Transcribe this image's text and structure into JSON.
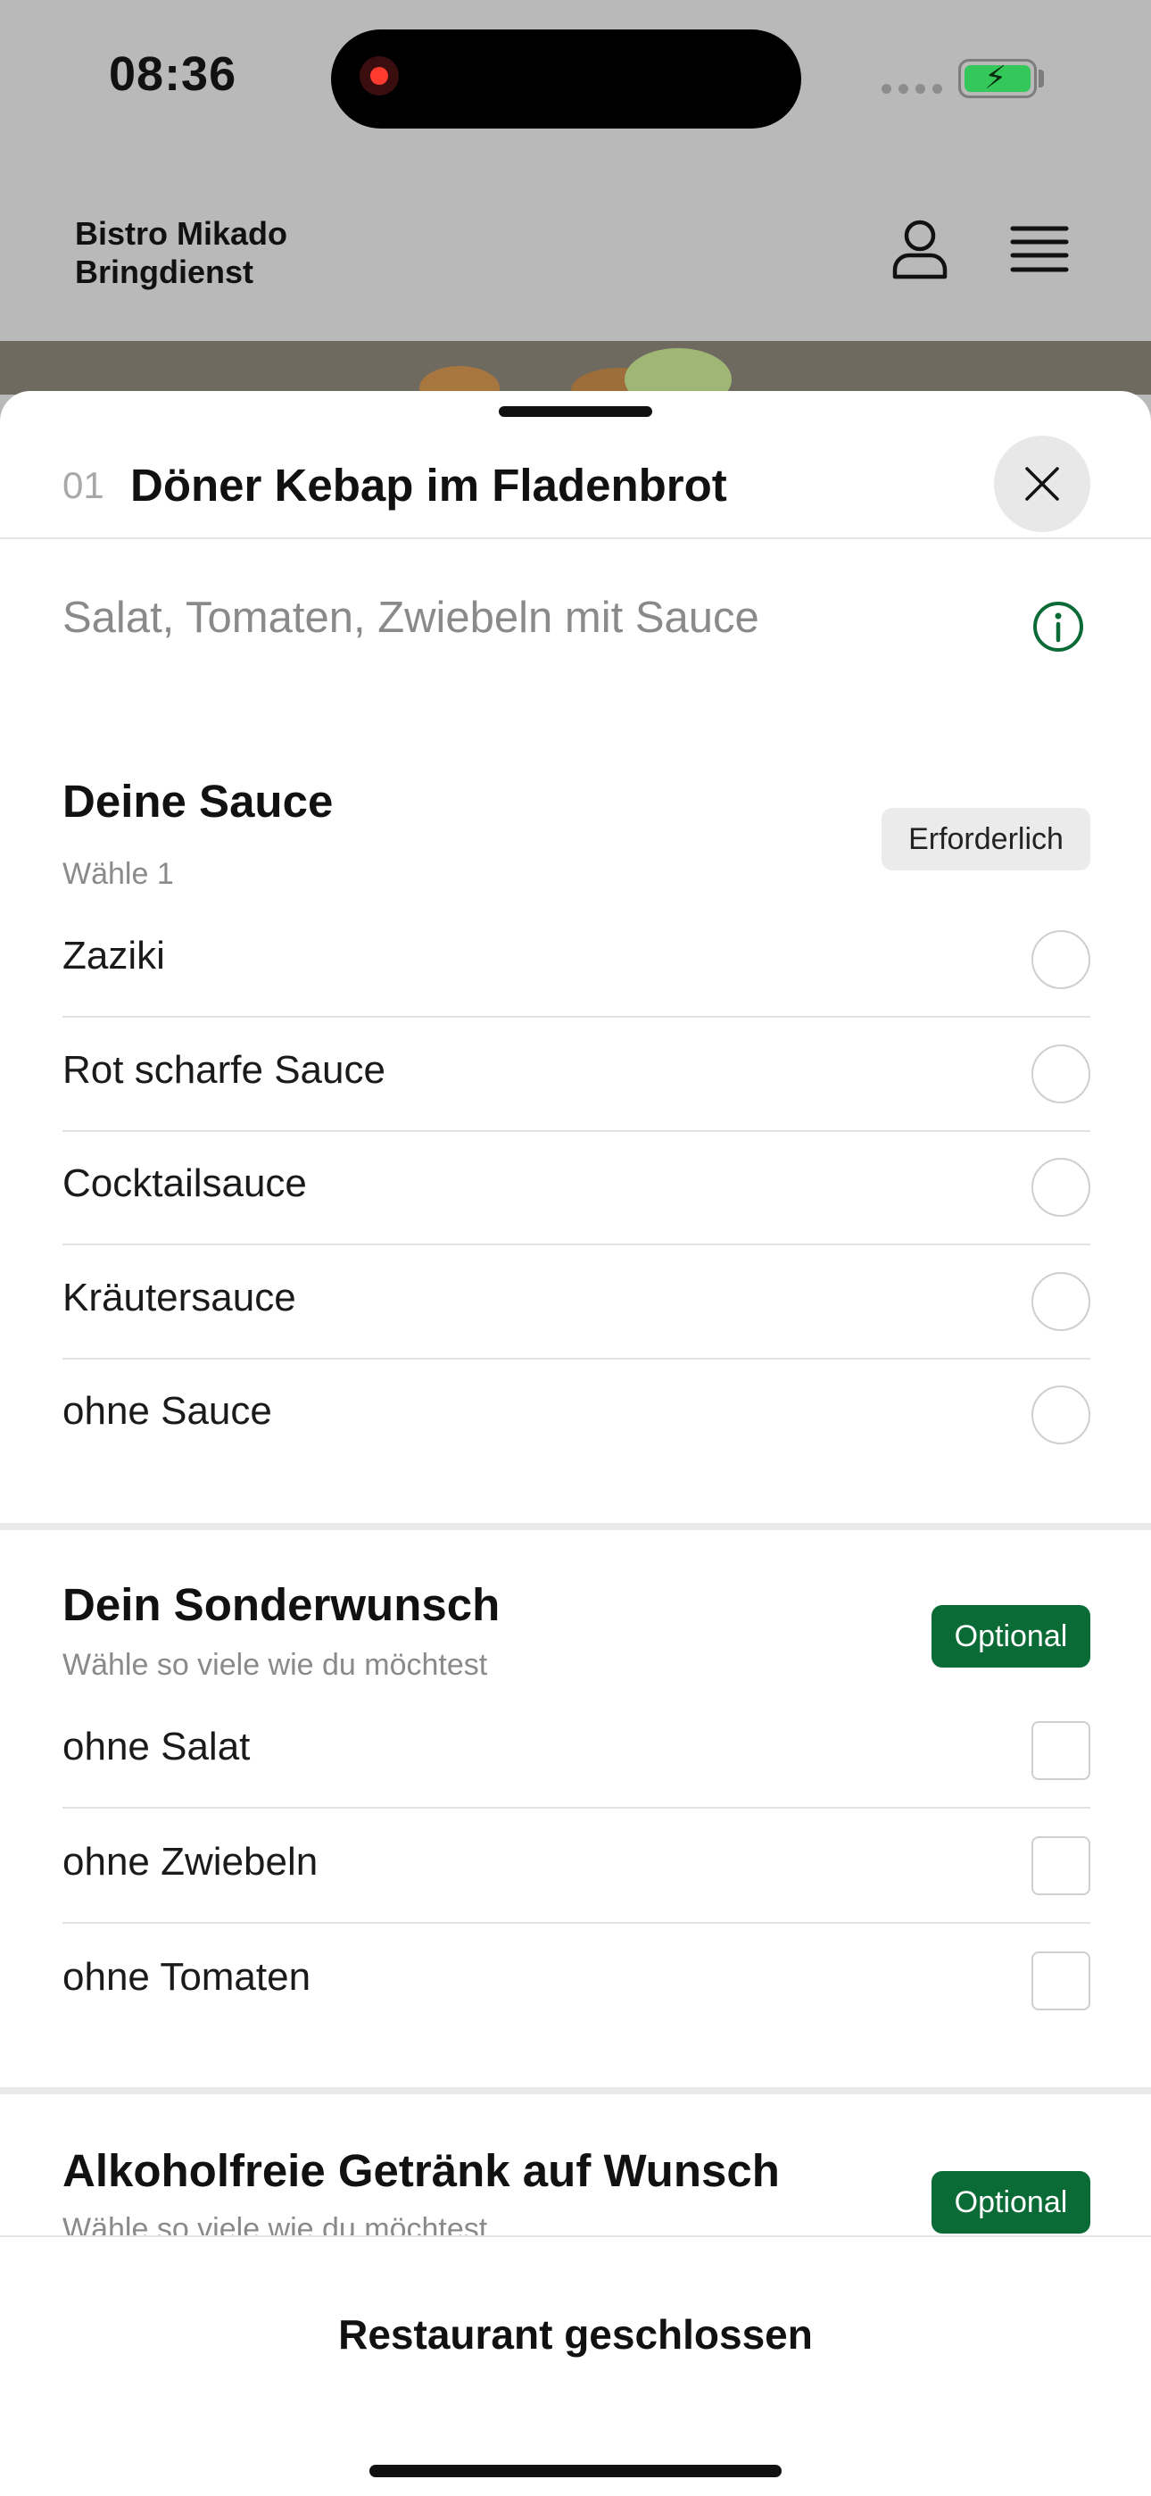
{
  "status": {
    "time": "08:36"
  },
  "header": {
    "brand_line1": "Bistro Mikado",
    "brand_line2": "Bringdienst",
    "user_icon": "person-icon",
    "menu_icon": "hamburger-menu-icon"
  },
  "item": {
    "number": "01",
    "title": "Döner Kebap im Fladenbrot",
    "description": "Salat, Tomaten, Zwiebeln mit Sauce"
  },
  "groups": [
    {
      "title": "Deine Sauce",
      "subtitle": "Wähle 1",
      "badge": "Erforderlich",
      "options": [
        "Zaziki",
        "Rot scharfe Sauce",
        "Cocktailsauce",
        "Kräutersauce",
        "ohne Sauce"
      ]
    },
    {
      "title": "Dein Sonderwunsch",
      "subtitle": "Wähle so viele wie du möchtest",
      "badge": "Optional",
      "options": [
        "ohne Salat",
        "ohne Zwiebeln",
        "ohne Tomaten"
      ]
    },
    {
      "title": "Alkoholfreie Getränk auf Wunsch",
      "subtitle": "Wähle so viele wie du möchtest",
      "badge": "Optional"
    }
  ],
  "footer": {
    "label": "Restaurant geschlossen"
  },
  "colors": {
    "accent_green": "#0a6b37",
    "battery_green": "#34c759",
    "recording_red": "#ff3b30"
  }
}
